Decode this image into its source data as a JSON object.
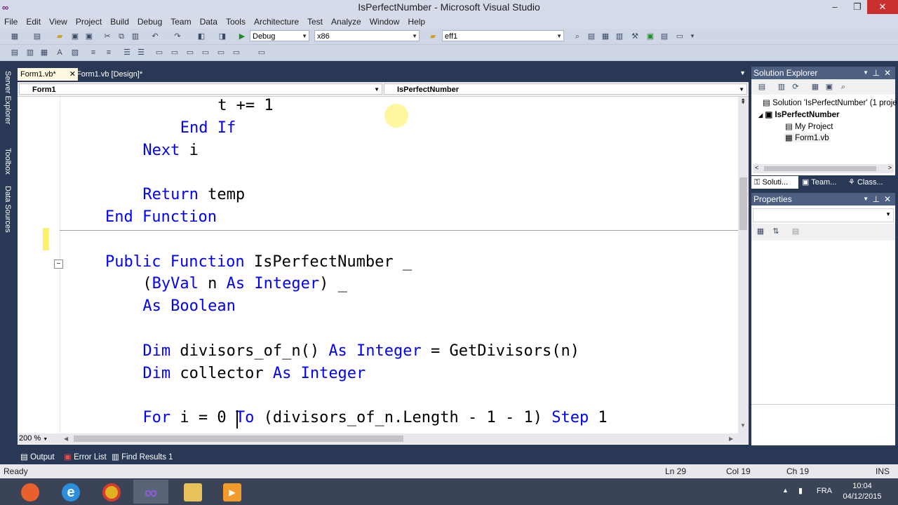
{
  "window": {
    "title": "IsPerfectNumber - Microsoft Visual Studio"
  },
  "menu": [
    "File",
    "Edit",
    "View",
    "Project",
    "Build",
    "Debug",
    "Team",
    "Data",
    "Tools",
    "Architecture",
    "Test",
    "Analyze",
    "Window",
    "Help"
  ],
  "toolbar": {
    "config": "Debug",
    "platform": "x86",
    "find": "eff1"
  },
  "side_tabs": [
    "Server Explorer",
    "Toolbox",
    "Data Sources"
  ],
  "doc_tabs": [
    {
      "label": "Form1.vb*",
      "active": true
    },
    {
      "label": "Form1.vb [Design]*",
      "active": false
    }
  ],
  "nav": {
    "class_combo": "Form1",
    "member_combo": "IsPerfectNumber"
  },
  "code_lines": [
    {
      "indent": 12,
      "tokens": [
        {
          "t": "t += 1",
          "k": false
        }
      ]
    },
    {
      "indent": 8,
      "tokens": [
        {
          "t": "End If",
          "k": true
        }
      ]
    },
    {
      "indent": 4,
      "tokens": [
        {
          "t": "Next",
          "k": true
        },
        {
          "t": " i",
          "k": false
        }
      ]
    },
    {
      "indent": 0,
      "tokens": []
    },
    {
      "indent": 4,
      "tokens": [
        {
          "t": "Return",
          "k": true
        },
        {
          "t": " temp",
          "k": false
        }
      ]
    },
    {
      "indent": 0,
      "tokens": [
        {
          "t": "End Function",
          "k": true
        }
      ]
    },
    {
      "indent": 0,
      "tokens": []
    },
    {
      "indent": 0,
      "tokens": [
        {
          "t": "Public Function",
          "k": true
        },
        {
          "t": " IsPerfectNumber _",
          "k": false
        }
      ]
    },
    {
      "indent": 4,
      "tokens": [
        {
          "t": "(",
          "k": false
        },
        {
          "t": "ByVal",
          "k": true
        },
        {
          "t": " n ",
          "k": false
        },
        {
          "t": "As Integer",
          "k": true
        },
        {
          "t": ") _",
          "k": false
        }
      ]
    },
    {
      "indent": 4,
      "tokens": [
        {
          "t": "As Boolean",
          "k": true
        }
      ]
    },
    {
      "indent": 0,
      "tokens": []
    },
    {
      "indent": 4,
      "tokens": [
        {
          "t": "Dim",
          "k": true
        },
        {
          "t": " divisors_of_n() ",
          "k": false
        },
        {
          "t": "As Integer",
          "k": true
        },
        {
          "t": " = GetDivisors(n)",
          "k": false
        }
      ]
    },
    {
      "indent": 4,
      "tokens": [
        {
          "t": "Dim",
          "k": true
        },
        {
          "t": " collector ",
          "k": false
        },
        {
          "t": "As Integer",
          "k": true
        }
      ]
    },
    {
      "indent": 0,
      "tokens": []
    },
    {
      "indent": 4,
      "tokens": [
        {
          "t": "For",
          "k": true
        },
        {
          "t": " i = 0 ",
          "k": false
        },
        {
          "t": "To",
          "k": true
        },
        {
          "t": " (divisors_of_n.Length - 1 - 1) ",
          "k": false
        },
        {
          "t": "Step",
          "k": true
        },
        {
          "t": " 1",
          "k": false
        }
      ]
    }
  ],
  "zoom": "200 %",
  "solution_explorer": {
    "title": "Solution Explorer",
    "items": [
      "Solution 'IsPerfectNumber' (1 proje",
      "IsPerfectNumber",
      "My Project",
      "Form1.vb"
    ],
    "tabs": [
      "Soluti...",
      "Team...",
      "Class..."
    ]
  },
  "properties": {
    "title": "Properties"
  },
  "bottom_tabs": [
    "Output",
    "Error List",
    "Find Results 1"
  ],
  "status": {
    "ready": "Ready",
    "ln": "Ln 29",
    "col": "Col 19",
    "ch": "Ch 19",
    "ins": "INS"
  },
  "tray": {
    "lang": "FRA",
    "time": "10:04",
    "date": "04/12/2015"
  },
  "colors": {
    "keyword": "#0000ff",
    "chrome": "#293955",
    "panel_header": "#4d6082"
  }
}
